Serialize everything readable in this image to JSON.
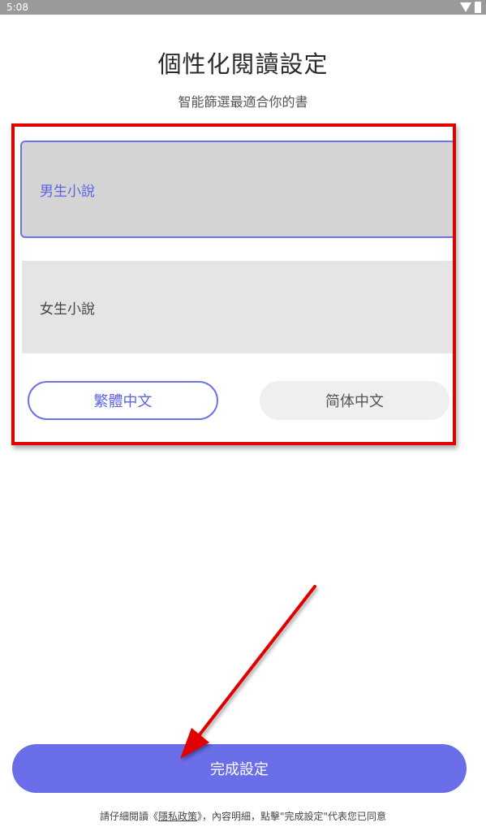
{
  "status_bar": {
    "time": "5:08",
    "icons": [
      "wifi-icon",
      "battery-icon"
    ]
  },
  "header": {
    "title": "個性化閱讀設定",
    "subtitle": "智能篩選最適合你的書"
  },
  "categories": [
    {
      "label": "男生小說",
      "selected": true
    },
    {
      "label": "女生小說",
      "selected": false
    }
  ],
  "language": {
    "options": [
      {
        "label": "繁體中文",
        "selected": true
      },
      {
        "label": "简体中文",
        "selected": false
      }
    ]
  },
  "complete_button": {
    "label": "完成設定"
  },
  "footer": {
    "prefix": "請仔細閱讀《",
    "privacy_link": "隱私政策",
    "suffix": "》，內容明細，點擊\"完成設定\"代表您已同意"
  },
  "colors": {
    "accent": "#6a6ee8",
    "annotation": "#e00000",
    "selected_card_bg": "#d4d4d4",
    "unselected_card_bg": "#e5e5e5"
  }
}
